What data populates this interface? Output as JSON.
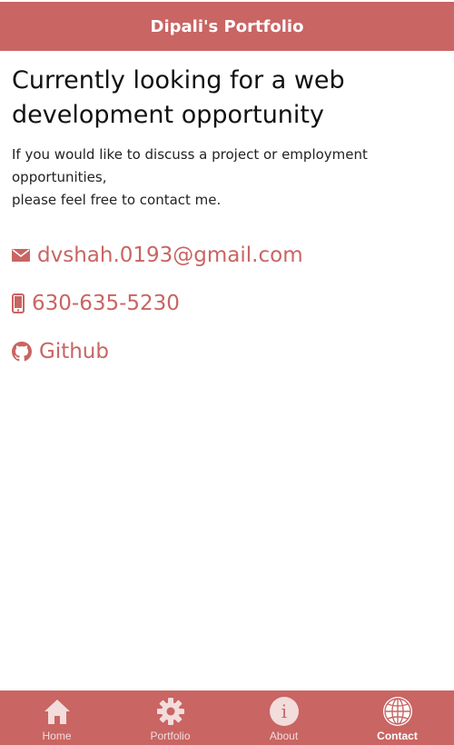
{
  "header": {
    "title": "Dipali's Portfolio"
  },
  "main": {
    "headline": "Currently looking for a web development opportunity",
    "intro_line1": "If you would like to discuss a project or employment opportunities,",
    "intro_line2": "please feel free to contact me.",
    "contacts": [
      {
        "icon": "envelope-icon",
        "label": "dvshah.0193@gmail.com"
      },
      {
        "icon": "phone-icon",
        "label": "630-635-5230"
      },
      {
        "icon": "github-icon",
        "label": "Github"
      }
    ]
  },
  "tabbar": {
    "items": [
      {
        "icon": "home-icon",
        "label": "Home"
      },
      {
        "icon": "gear-icon",
        "label": "Portfolio"
      },
      {
        "icon": "info-icon",
        "label": "About"
      },
      {
        "icon": "globe-icon",
        "label": "Contact",
        "active": true
      }
    ]
  },
  "colors": {
    "accent": "#c96563",
    "text": "#111111",
    "tab_inactive": "#f3dcdc"
  }
}
